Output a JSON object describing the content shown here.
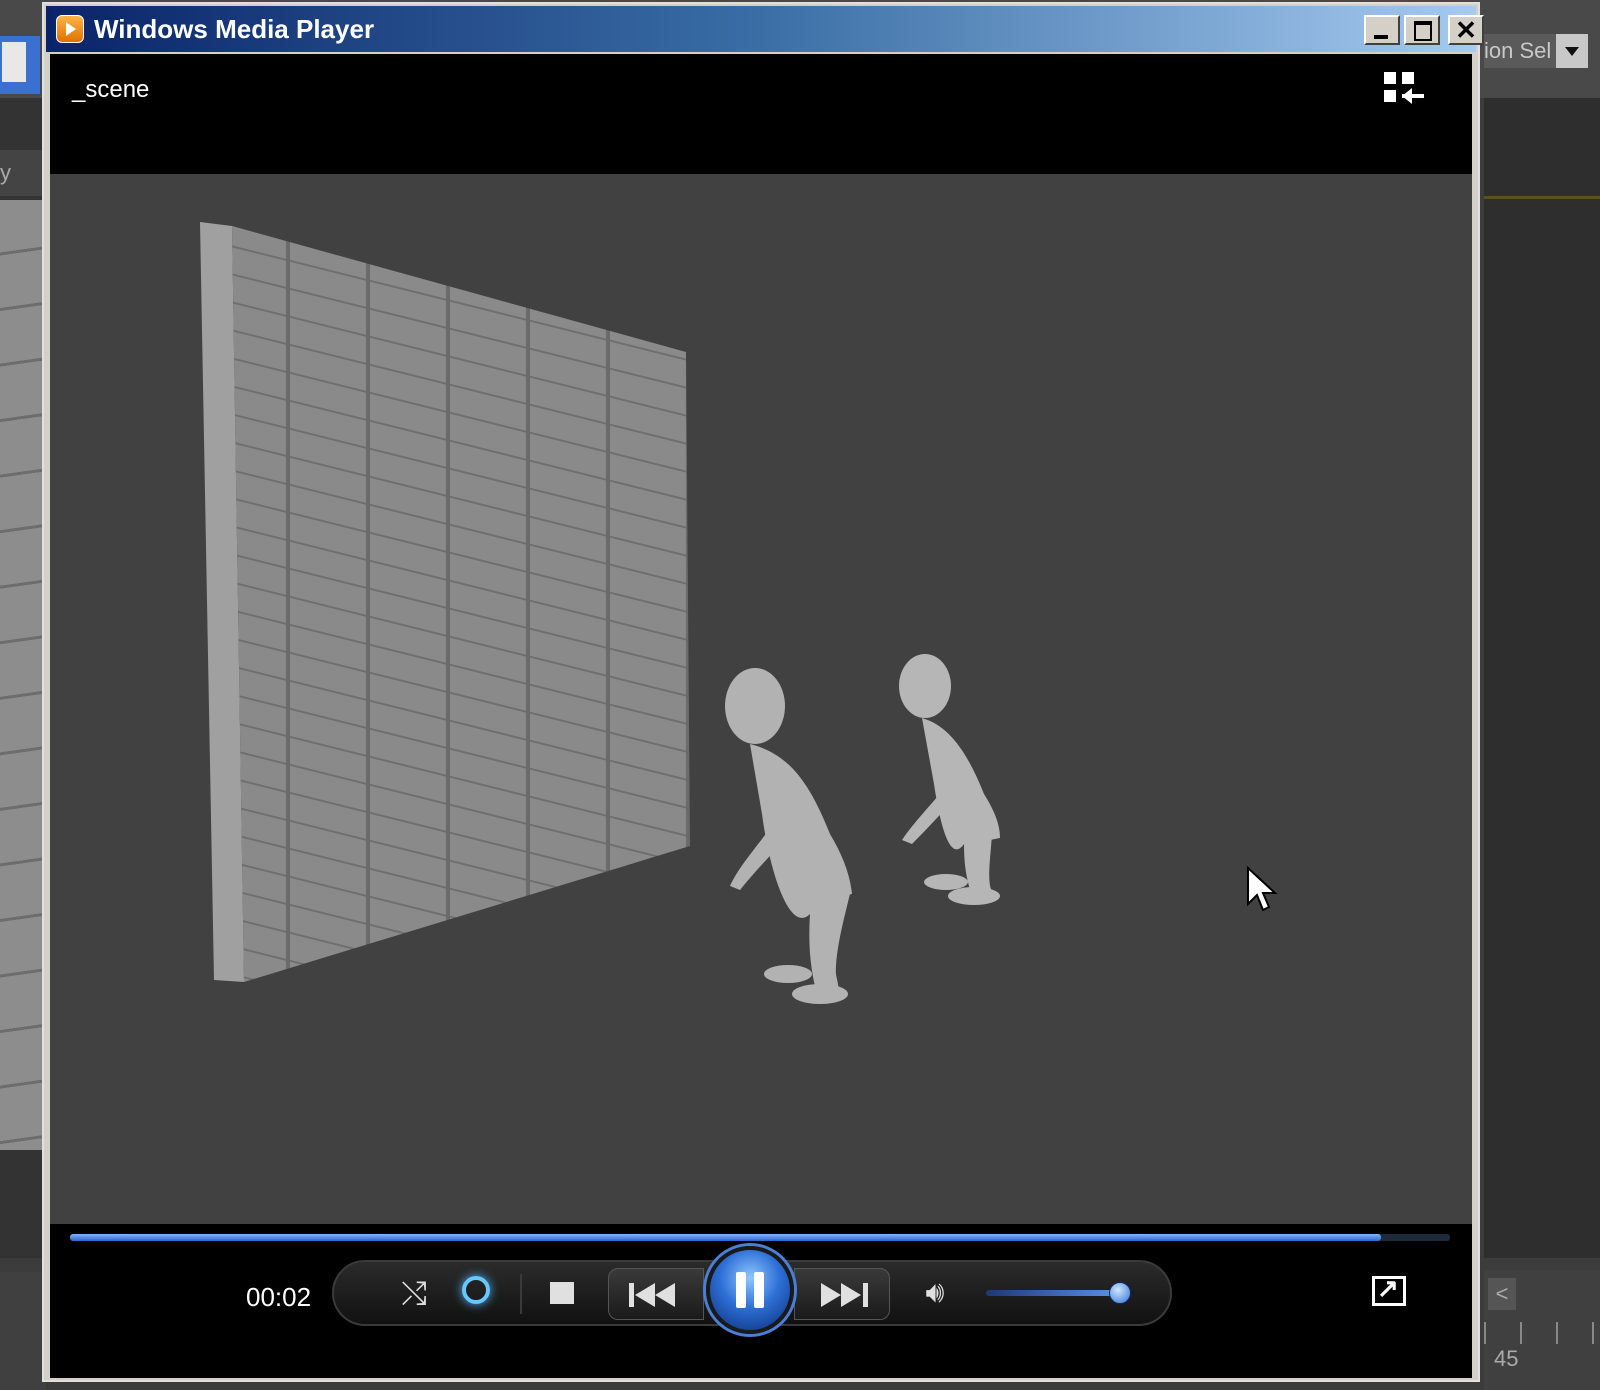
{
  "window": {
    "title": "Windows Media Player",
    "controls": {
      "minimize": "minimize",
      "maximize": "maximize",
      "close": "✕"
    }
  },
  "media": {
    "name": "_scene"
  },
  "playback": {
    "current_time": "00:02",
    "progress": 0.95,
    "volume": 0.93,
    "state": "playing"
  },
  "icons": {
    "app": "wmp-icon",
    "view_toggle": "switch-to-library-icon",
    "shuffle": "shuffle-icon",
    "repeat": "repeat-icon",
    "stop": "stop-icon",
    "previous": "previous-icon",
    "pause": "pause-icon",
    "next": "next-icon",
    "volume": "volume-icon",
    "now_playing": "switch-to-now-playing-icon",
    "cursor": "mouse-cursor-icon"
  },
  "colors": {
    "titlebar_start": "#0a246a",
    "titlebar_end": "#a6caf0",
    "video_bg": "#414141",
    "accent_blue": "#2e6fd6"
  },
  "background_app": {
    "left_tab": "y",
    "dropdown_text": "ion Sel",
    "back_button": "<",
    "timeline_number": "45"
  }
}
